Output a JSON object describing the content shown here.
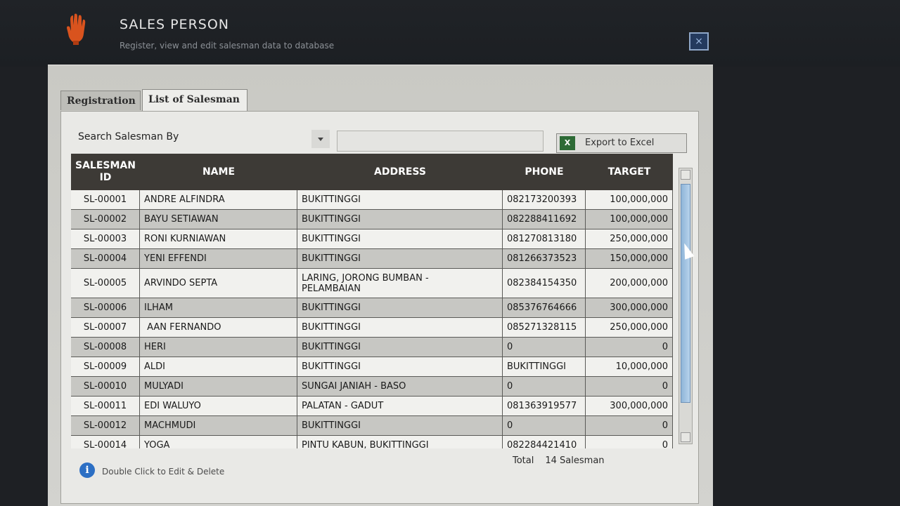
{
  "header": {
    "title": "SALES PERSON",
    "subtitle": "Register, view and edit salesman data to database",
    "close_icon": "close-icon"
  },
  "tabs": [
    {
      "label": "Registration",
      "active": false
    },
    {
      "label": "List of Salesman",
      "active": true
    }
  ],
  "search": {
    "label": "Search Salesman By",
    "selected": "",
    "value": ""
  },
  "export": {
    "label": "Export to Excel",
    "icon": "excel-icon"
  },
  "table": {
    "columns": [
      "SALESMAN\nID",
      "NAME",
      "ADDRESS",
      "PHONE",
      "TARGET"
    ],
    "rows": [
      [
        "SL-00001",
        "ANDRE ALFINDRA",
        "BUKITTINGGI",
        "082173200393",
        "100,000,000"
      ],
      [
        "SL-00002",
        "BAYU SETIAWAN",
        "BUKITTINGGI",
        "082288411692",
        "100,000,000"
      ],
      [
        "SL-00003",
        "RONI KURNIAWAN",
        "BUKITTINGGI",
        "081270813180",
        "250,000,000"
      ],
      [
        "SL-00004",
        "YENI EFFENDI",
        "BUKITTINGGI",
        "081266373523",
        "150,000,000"
      ],
      [
        "SL-00005",
        "ARVINDO SEPTA",
        "LARING, JORONG BUMBAN -\nPELAMBAIAN",
        "082384154350",
        "200,000,000"
      ],
      [
        "SL-00006",
        "ILHAM",
        "BUKITTINGGI",
        "085376764666",
        "300,000,000"
      ],
      [
        "SL-00007",
        " AAN FERNANDO",
        "BUKITTINGGI",
        "085271328115",
        "250,000,000"
      ],
      [
        "SL-00008",
        "HERI",
        "BUKITTINGGI",
        "0",
        "0"
      ],
      [
        "SL-00009",
        "ALDI",
        "BUKITTINGGI",
        "BUKITTINGGI",
        "10,000,000"
      ],
      [
        "SL-00010",
        "MULYADI",
        "SUNGAI JANIAH - BASO",
        "0",
        "0"
      ],
      [
        "SL-00011",
        "EDI WALUYO",
        "PALATAN - GADUT",
        "081363919577",
        "300,000,000"
      ],
      [
        "SL-00012",
        "MACHMUDI",
        "BUKITTINGGI",
        "0",
        "0"
      ],
      [
        "SL-00014",
        "YOGA",
        "PINTU KABUN, BUKITTINGGI",
        "082284421410",
        "0"
      ]
    ]
  },
  "footer": {
    "hint": "Double Click to Edit & Delete",
    "total_label": "Total",
    "total_value": "14 Salesman"
  }
}
